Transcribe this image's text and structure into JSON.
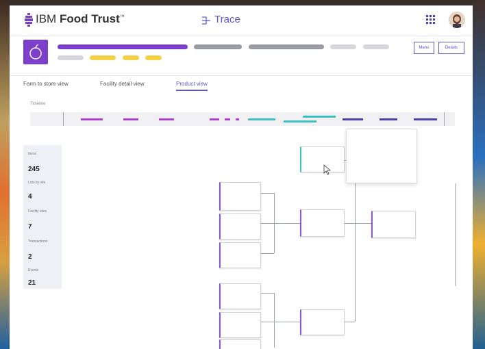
{
  "app": {
    "brand_prefix": "IBM",
    "brand_name": "Food Trust",
    "brand_tm": "™",
    "module": "Trace"
  },
  "header": {
    "buttons": [
      {
        "label": "Menu"
      },
      {
        "label": "Details"
      }
    ]
  },
  "tabs": [
    {
      "label": "Farm to store view"
    },
    {
      "label": "Facility detail view"
    },
    {
      "label": "Product view"
    }
  ],
  "timeline": {
    "label": "Timeline"
  },
  "stats": [
    {
      "label": "Items",
      "value": "245"
    },
    {
      "label": "Lots by site",
      "value": "4"
    },
    {
      "label": "Facility sites",
      "value": "7"
    },
    {
      "label": "Transactions",
      "value": "2"
    },
    {
      "label": "Events",
      "value": "21"
    }
  ],
  "colors": {
    "accent": "#5b56d8",
    "product_purple": "#7b3fc9",
    "timeline_purple": "#b13fd6",
    "timeline_teal": "#3bbfc0",
    "timeline_indigo": "#4b3faf",
    "chip_yellow": "#f3d24a",
    "chip_gray": "#9a9aa5"
  },
  "icons": {
    "brand": "brand-logo-icon",
    "trace": "trace-icon",
    "apps": "app-grid-icon",
    "product": "product-apple-icon",
    "cursor": "cursor-icon"
  }
}
